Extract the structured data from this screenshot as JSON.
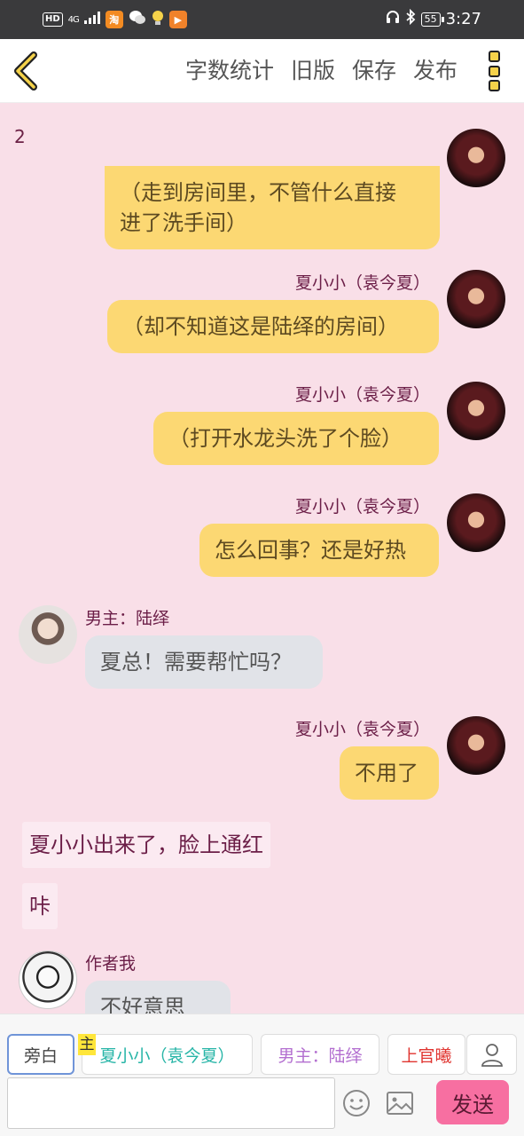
{
  "status_bar": {
    "network": "4G",
    "battery": "55",
    "time": "3:27"
  },
  "header": {
    "actions": [
      "字数统计",
      "旧版",
      "保存",
      "发布"
    ]
  },
  "chat": {
    "page_number": "2",
    "partial_message": "（走到房间里，不管什么直接进了洗手间）",
    "partial_message_lines": [
      "（走到房间里，不管什么直接",
      "进了洗手间）"
    ],
    "messages": [
      {
        "speaker": "夏小小（袁今夏）",
        "text": "（却不知道这是陆绎的房间）"
      },
      {
        "speaker": "夏小小（袁今夏）",
        "text": "（打开水龙头洗了个脸）"
      },
      {
        "speaker": "夏小小（袁今夏）",
        "text": "怎么回事？还是好热"
      },
      {
        "speaker": "男主：陆绎",
        "text": "夏总！需要帮忙吗？"
      },
      {
        "speaker": "夏小小（袁今夏）",
        "text": "不用了"
      }
    ],
    "narrations": [
      "夏小小出来了，脸上通红",
      "咔"
    ],
    "author_message": {
      "speaker": "作者我",
      "text": "不好意思"
    }
  },
  "role_selector": {
    "host_tag": "主",
    "roles": [
      {
        "label": "旁白",
        "color": "#444444"
      },
      {
        "label": "夏小小（袁今夏）",
        "color": "#27b5a7"
      },
      {
        "label": "男主：陆绎",
        "color": "#b36fd0"
      },
      {
        "label": "上官曦",
        "color": "#e0342f"
      }
    ]
  },
  "input": {
    "placeholder": "",
    "send_label": "发送"
  },
  "icons": [
    "back-arrow-icon",
    "more-menu-icon",
    "user-icon",
    "emoji-icon",
    "image-icon"
  ]
}
